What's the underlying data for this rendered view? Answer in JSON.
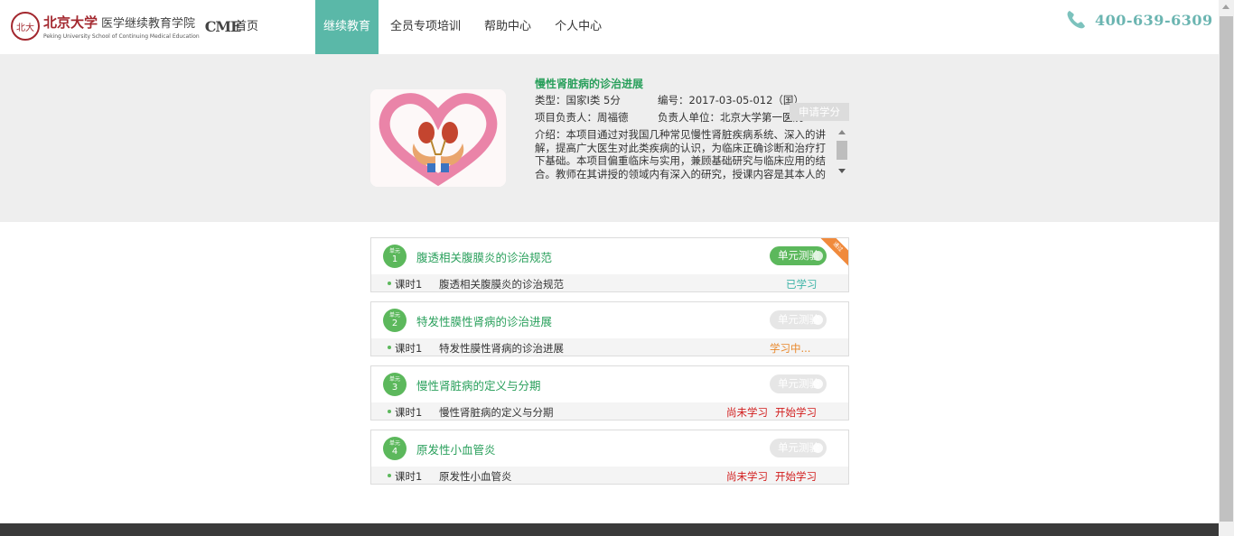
{
  "header": {
    "logo_seal": "北大",
    "logo_cn_main": "北京大学",
    "logo_cn_sub": "医学继续教育学院",
    "logo_en": "Peking University School of Continuing Medical Education",
    "logo_cme": "CME",
    "nav": [
      {
        "label": "首页",
        "active": false
      },
      {
        "label": "继续教育",
        "active": true
      },
      {
        "label": "全员专项培训",
        "active": false
      },
      {
        "label": "帮助中心",
        "active": false
      },
      {
        "label": "个人中心",
        "active": false
      }
    ],
    "phone": "400-639-6309"
  },
  "course": {
    "title": "慢性肾脏病的诊治进展",
    "type": "类型：国家I类 5分",
    "code": "编号：2017-03-05-012（国）",
    "leader": "项目负责人：周福德",
    "unit": "负责人单位：北京大学第一医院",
    "apply_label": "申请学分",
    "intro": "介绍：本项目通过对我国几种常见慢性肾脏疾病系统、深入的讲解，提高广大医生对此类疾病的认识，为临床正确诊断和治疗打下基础。本项目偏重临床与实用，兼顾基础研究与临床应用的结合。教师在其讲授的领域内有深入的研究，授课内容是其本人的临床经验的总结。"
  },
  "units": [
    {
      "badge_small": "单元",
      "number": "1",
      "title": "腹透相关腹膜炎的诊治规范",
      "test_label": "单元测验",
      "test_enabled": true,
      "corner_tag": "通过",
      "lesson_no": "课时1",
      "lesson_name": "腹透相关腹膜炎的诊治规范",
      "status": "已学习",
      "status_kind": "done",
      "action": ""
    },
    {
      "badge_small": "单元",
      "number": "2",
      "title": "特发性膜性肾病的诊治进展",
      "test_label": "单元测验",
      "test_enabled": false,
      "corner_tag": "",
      "lesson_no": "课时1",
      "lesson_name": "特发性膜性肾病的诊治进展",
      "status": "学习中...",
      "status_kind": "ing",
      "action": ""
    },
    {
      "badge_small": "单元",
      "number": "3",
      "title": "慢性肾脏病的定义与分期",
      "test_label": "单元测验",
      "test_enabled": false,
      "corner_tag": "",
      "lesson_no": "课时1",
      "lesson_name": "慢性肾脏病的定义与分期",
      "status": "尚未学习",
      "status_kind": "none",
      "action": "开始学习"
    },
    {
      "badge_small": "单元",
      "number": "4",
      "title": "原发性小血管炎",
      "test_label": "单元测验",
      "test_enabled": false,
      "corner_tag": "",
      "lesson_no": "课时1",
      "lesson_name": "原发性小血管炎",
      "status": "尚未学习",
      "status_kind": "none",
      "action": "开始学习"
    }
  ],
  "colors": {
    "accent": "#5ab8a8",
    "title_green": "#2aa05c",
    "badge_green": "#5cb85c",
    "phone_teal": "#6bb5b1",
    "warn_orange": "#e8872a",
    "danger_red": "#d11a1a"
  }
}
